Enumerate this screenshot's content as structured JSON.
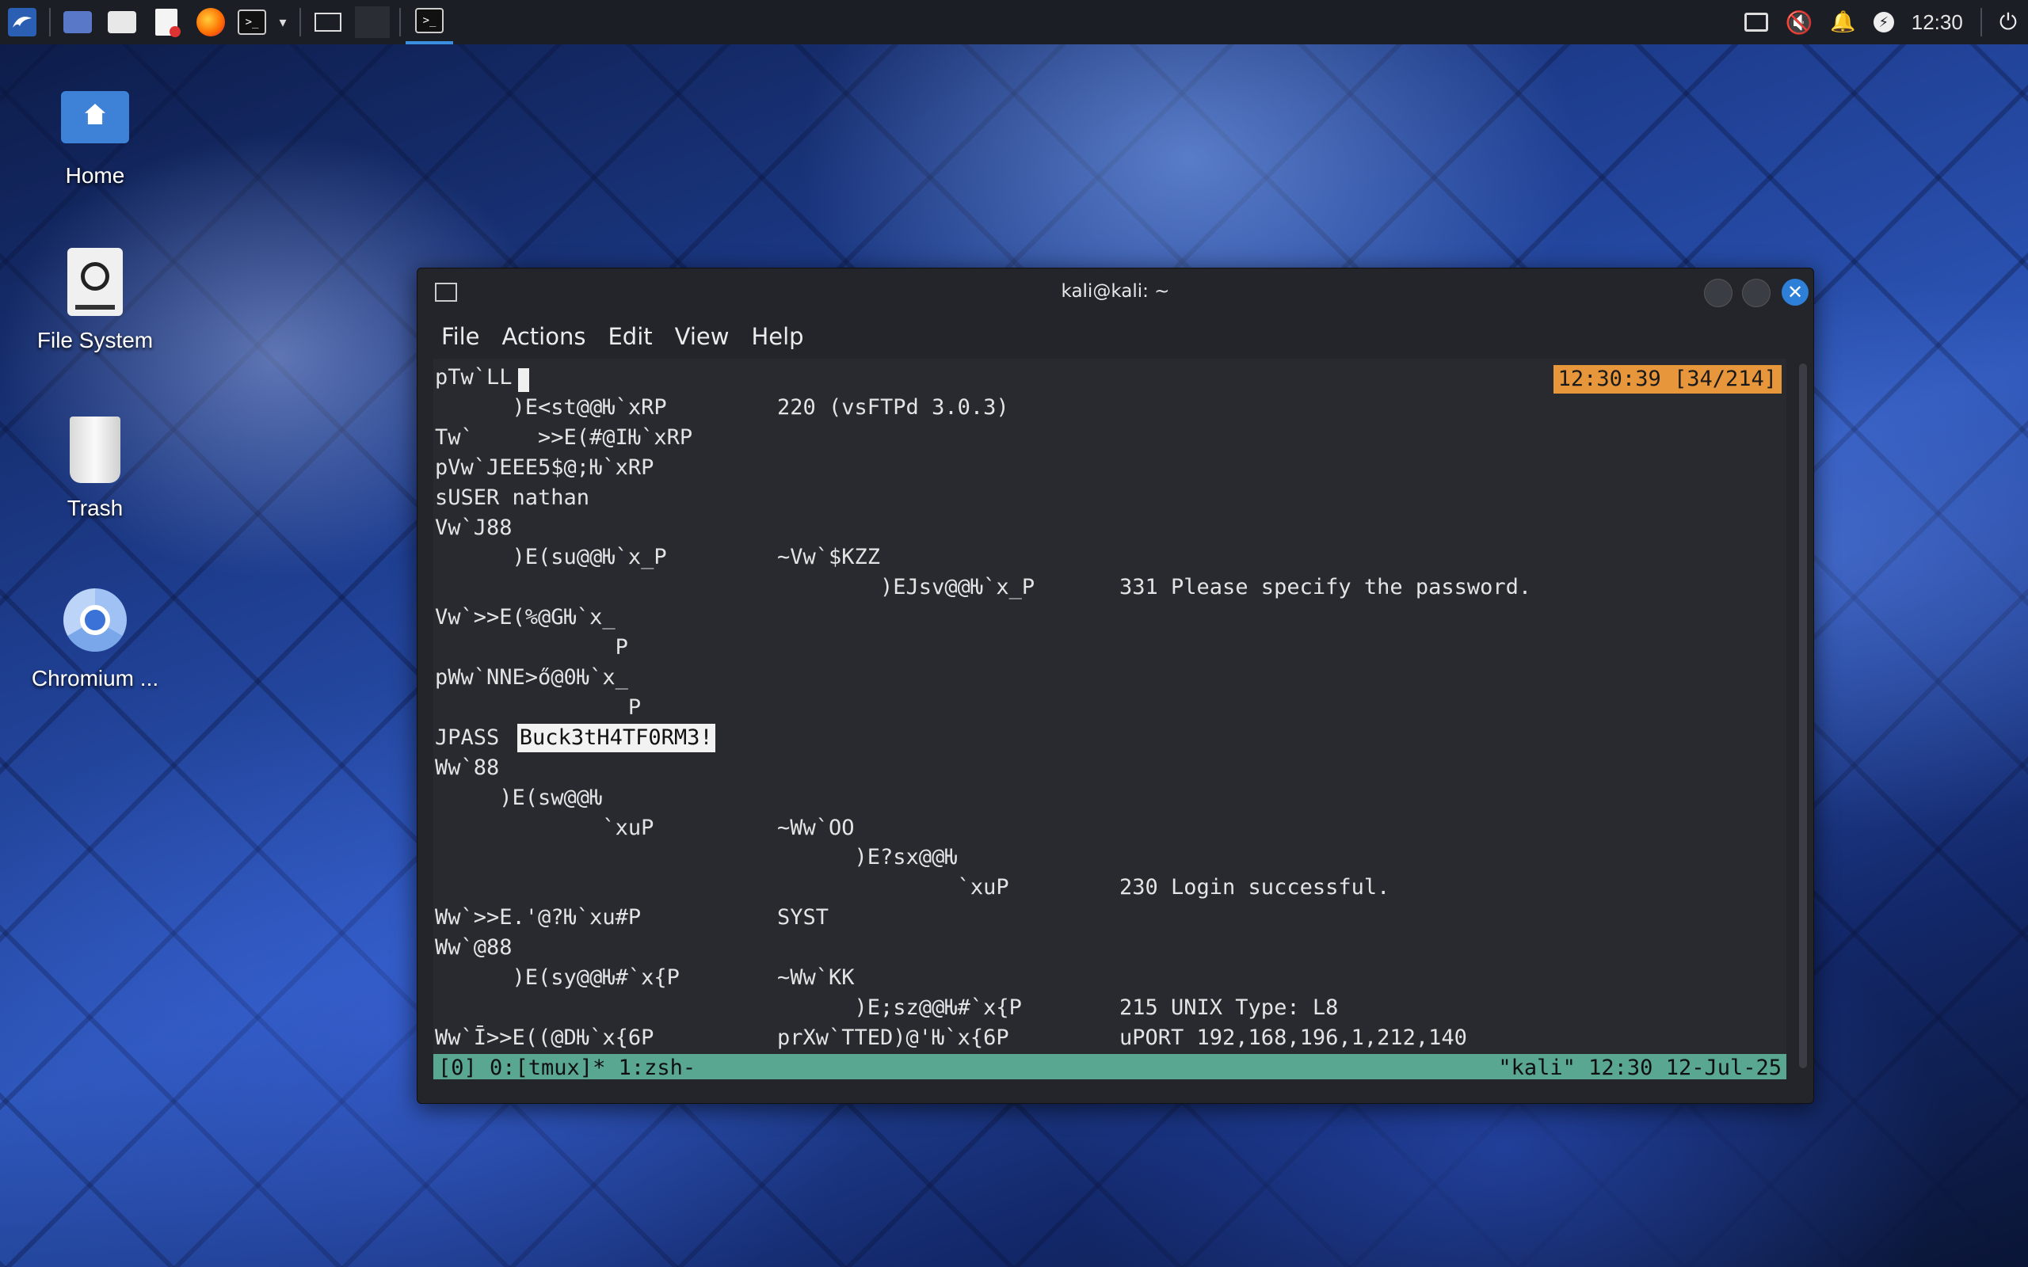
{
  "panel": {
    "clock": "12:30"
  },
  "desktop": {
    "icons": [
      {
        "label": "Home"
      },
      {
        "label": "File System"
      },
      {
        "label": "Trash"
      },
      {
        "label": "Chromium ..."
      }
    ]
  },
  "window": {
    "title": "kali@kali: ~",
    "menu": [
      "File",
      "Actions",
      "Edit",
      "View",
      "Help"
    ]
  },
  "terminal": {
    "timestamp": "12:30:39 [34/214]",
    "lines": [
      {
        "col1": "pTw`LL",
        "col2": "",
        "col3": ""
      },
      {
        "col1": "      )E<st@@Ƕ`xRP",
        "col2": "220 (vsFTPd 3.0.3)",
        "col3": ""
      },
      {
        "col1": "Tw`     >>E(#@IǶ`xRP",
        "col2": "",
        "col3": ""
      },
      {
        "col1": "pVw`JEEE5$@;Ƕ`xRP",
        "col2": "",
        "col3": ""
      },
      {
        "col1": "sUSER nathan",
        "col2": "",
        "col3": ""
      },
      {
        "col1": "Vw`J88",
        "col2": "",
        "col3": ""
      },
      {
        "col1": "      )E(su@@Ƕ`x_P",
        "col2": "~Vw`$KZZ",
        "col3": ""
      },
      {
        "col1": "",
        "col2": "        )EJsv@@Ƕ`x_P",
        "col3": "331 Please specify the password."
      },
      {
        "col1": "Vw`>>E(%@GǶ`x_",
        "col2": "",
        "col3": ""
      },
      {
        "col1": "              P",
        "col2": "",
        "col3": ""
      },
      {
        "col1": "pWw`NNE>ő@0Ƕ`x_",
        "col2": "",
        "col3": ""
      },
      {
        "col1": "               P",
        "col2": "",
        "col3": ""
      },
      {
        "col1": "JPASS ",
        "col2": "",
        "col3": ""
      },
      {
        "col1": "Ww`88",
        "col2": "",
        "col3": ""
      },
      {
        "col1": "     )E(sw@@Ƕ",
        "col2": "",
        "col3": ""
      },
      {
        "col1": "             `xuP",
        "col2": "~Ww`OO",
        "col3": ""
      },
      {
        "col1": "",
        "col2": "      )E?sx@@Ƕ",
        "col3": ""
      },
      {
        "col1": "",
        "col2": "              `xuP",
        "col3": "230 Login successful."
      },
      {
        "col1": "Ww`>>E.'@?Ƕ`xu#P",
        "col2": "SYST",
        "col3": ""
      },
      {
        "col1": "Ww`@88",
        "col2": "",
        "col3": ""
      },
      {
        "col1": "      )E(sy@@Ƕ#`x{P",
        "col2": "~Ww`KK",
        "col3": ""
      },
      {
        "col1": "",
        "col2": "      )E;sz@@Ƕ#`x{P",
        "col3": "215 UNIX Type: L8"
      },
      {
        "col1": "Ww`Ī>>E((@DǶ`x{6P",
        "col2": "prXw`TTED)@'Ƕ`x{6P",
        "col3": "uPORT 192,168,196,1,212,140"
      }
    ],
    "password": "Buck3tH4TF0RM3!",
    "status_left": "[0] 0:[tmux]* 1:zsh-",
    "status_right": "\"kali\" 12:30 12-Jul-25"
  }
}
